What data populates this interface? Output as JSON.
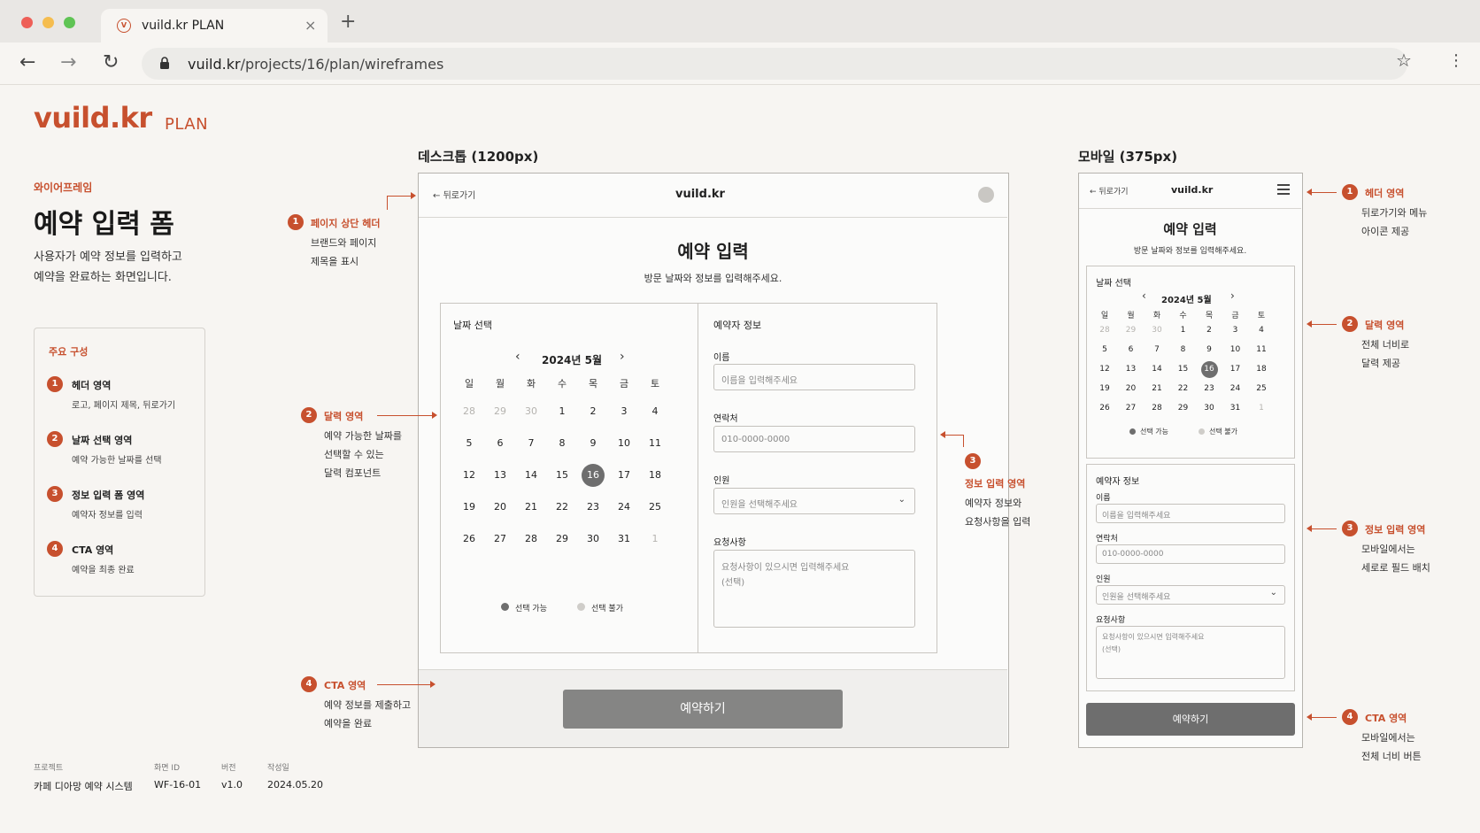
{
  "browser": {
    "tab_title": "vuild.kr PLAN",
    "url_host": "vuild.kr",
    "url_path": "/projects/16/plan/wireframes",
    "new_tab": "+",
    "close": "×"
  },
  "doc": {
    "brand": "vuild.kr",
    "brand_sub": "PLAN",
    "eyebrow": "와이어프레임",
    "title": "예약 입력 폼",
    "description_line1": "사용자가 예약 정보를 입력하고",
    "description_line2": "예약을 완료하는 화면입니다.",
    "components_title": "주요 구성",
    "components": [
      {
        "num": "1",
        "name": "헤더 영역",
        "desc": "로고, 페이지 제목, 뒤로가기"
      },
      {
        "num": "2",
        "name": "날짜 선택 영역",
        "desc": "예약 가능한 날짜를 선택"
      },
      {
        "num": "3",
        "name": "정보 입력 폼 영역",
        "desc": "예약자 정보를 입력"
      },
      {
        "num": "4",
        "name": "CTA 영역",
        "desc": "예약을 최종 완료"
      }
    ],
    "meta": [
      {
        "label": "프로젝트",
        "value": "카페 디아망 예약 시스템"
      },
      {
        "label": "화면 ID",
        "value": "WF-16-01"
      },
      {
        "label": "버전",
        "value": "v1.0"
      },
      {
        "label": "작성일",
        "value": "2024.05.20"
      }
    ]
  },
  "desktop": {
    "section_label": "데스크톱 (1200px)",
    "back": "뒤로가기",
    "logo": "vuild.kr",
    "title": "예약 입력",
    "subtitle": "방문 날짜와 정보를 입력해주세요.",
    "calendar_label": "날짜 선택",
    "month": "2024년 5월",
    "weekdays": [
      "일",
      "월",
      "화",
      "수",
      "목",
      "금",
      "토"
    ],
    "days": [
      [
        "28",
        "29",
        "30",
        "1",
        "2",
        "3",
        "4"
      ],
      [
        "5",
        "6",
        "7",
        "8",
        "9",
        "10",
        "11"
      ],
      [
        "12",
        "13",
        "14",
        "15",
        "16",
        "17",
        "18"
      ],
      [
        "19",
        "20",
        "21",
        "22",
        "23",
        "24",
        "25"
      ],
      [
        "26",
        "27",
        "28",
        "29",
        "30",
        "31",
        "1"
      ]
    ],
    "legend_available": "선택 가능",
    "legend_unavailable": "선택 불가",
    "form_label": "예약자 정보",
    "name_label": "이름",
    "name_placeholder": "이름을 입력해주세요",
    "phone_label": "연락처",
    "phone_placeholder": "010-0000-0000",
    "people_label": "인원",
    "people_placeholder": "인원을 선택해주세요",
    "request_label": "요청사항",
    "request_placeholder_1": "요청사항이 있으시면 입력해주세요",
    "request_placeholder_2": "(선택)",
    "cta": "예약하기"
  },
  "mobile": {
    "section_label": "모바일 (375px)",
    "back": "뒤로가기",
    "logo": "vuild.kr",
    "title": "예약 입력",
    "subtitle": "방문 날짜와 정보를 입력해주세요.",
    "calendar_label": "날짜 선택",
    "month": "2024년 5월",
    "legend_available": "선택 가능",
    "legend_unavailable": "선택 불가",
    "form_label": "예약자 정보",
    "name_label": "이름",
    "name_placeholder": "이름을 입력해주세요",
    "phone_label": "연락처",
    "phone_placeholder": "010-0000-0000",
    "people_label": "인원",
    "people_placeholder": "인원을 선택해주세요",
    "request_label": "요청사항",
    "request_placeholder_1": "요청사항이 있으시면 입력해주세요",
    "request_placeholder_2": "(선택)",
    "cta": "예약하기"
  },
  "annotations_desktop": [
    {
      "num": "1",
      "title": "페이지 상단 헤더",
      "line1": "브랜드와 페이지",
      "line2": "제목을 표시",
      "line3": ""
    },
    {
      "num": "2",
      "title": "달력 영역",
      "line1": "예약 가능한 날짜를",
      "line2": "선택할 수 있는",
      "line3": "달력 컴포넌트"
    },
    {
      "num": "3",
      "title": "정보 입력 영역",
      "line1": "예약자 정보와",
      "line2": "요청사항을 입력",
      "line3": ""
    },
    {
      "num": "4",
      "title": "CTA 영역",
      "line1": "예약 정보를 제출하고",
      "line2": "예약을 완료",
      "line3": ""
    }
  ],
  "annotations_mobile": [
    {
      "num": "1",
      "title": "헤더 영역",
      "line1": "뒤로가기와 메뉴",
      "line2": "아이콘 제공"
    },
    {
      "num": "2",
      "title": "달력 영역",
      "line1": "전체 너비로",
      "line2": "달력 제공"
    },
    {
      "num": "3",
      "title": "정보 입력 영역",
      "line1": "모바일에서는",
      "line2": "세로로 필드 배치"
    },
    {
      "num": "4",
      "title": "CTA 영역",
      "line1": "모바일에서는",
      "line2": "전체 너비 버튼"
    }
  ],
  "colors": {
    "accent": "#c7502e",
    "selected_day": "#6e6e6e",
    "cta_desktop": "#858584",
    "cta_mobile": "#6e6e6e"
  }
}
